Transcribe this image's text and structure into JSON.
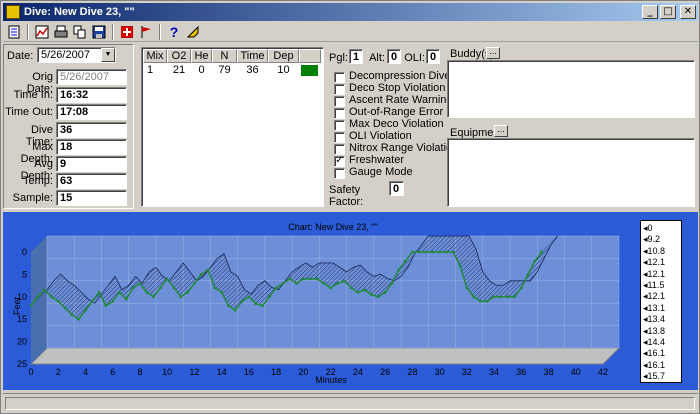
{
  "window": {
    "title": "Dive: New Dive 23, \"\"",
    "minimize": "_",
    "maximize": "□",
    "close": "✕"
  },
  "toolbar": {
    "icons": [
      "log-icon",
      "chart-icon",
      "print-icon",
      "copy-icon",
      "save-icon",
      "first-aid-icon",
      "flag-icon",
      "help-icon",
      "pointer-icon"
    ]
  },
  "details": {
    "date_label": "Date:",
    "date_value": "5/26/2007",
    "orig_date_label": "Orig Date:",
    "orig_date_value": "5/26/2007",
    "time_in_label": "Time In:",
    "time_in_value": "16:32",
    "time_out_label": "Time Out:",
    "time_out_value": "17:08",
    "dive_time_label": "Dive Time:",
    "dive_time_value": "36",
    "max_depth_label": "Max Depth:",
    "max_depth_value": "18",
    "avg_depth_label": "Avg Depth:",
    "avg_depth_value": "9",
    "temp_label": "Temp:",
    "temp_value": "63",
    "sample_label": "Sample:",
    "sample_value": "15"
  },
  "mix_table": {
    "headers": [
      "Mix",
      "O2",
      "He",
      "N",
      "Time",
      "Dep"
    ],
    "rows": [
      [
        "1",
        "21",
        "0",
        "79",
        "36",
        "10"
      ]
    ],
    "row_color": "#008000"
  },
  "indicators": {
    "pgl_label": "Pgl:",
    "pgl_value": "1",
    "alt_label": "Alt:",
    "alt_value": "0",
    "oli_label": "OLI:",
    "oli_value": "0"
  },
  "flags": [
    {
      "label": "Decompression Dive",
      "checked": false
    },
    {
      "label": "Deco Stop Violation",
      "checked": false
    },
    {
      "label": "Ascent Rate Warning",
      "checked": false
    },
    {
      "label": "Out-of-Range Error",
      "checked": false
    },
    {
      "label": "Max Deco Violation",
      "checked": false
    },
    {
      "label": "OLI Violation",
      "checked": false
    },
    {
      "label": "Nitrox Range Violation",
      "checked": false
    },
    {
      "label": "Freshwater",
      "checked": true
    },
    {
      "label": "Gauge Mode",
      "checked": false
    }
  ],
  "safety": {
    "label": "Safety Factor:",
    "value": "0"
  },
  "buddy": {
    "label": "Buddy(s)",
    "button": "..."
  },
  "equipment": {
    "label": "Equipment",
    "button": "..."
  },
  "chart_data": {
    "type": "area",
    "title": "Chart: New Dive 23, \"\"",
    "xlabel": "Minutes",
    "ylabel": "Feet",
    "xlim": [
      0,
      42
    ],
    "ylim": [
      0,
      25
    ],
    "y_reversed": true,
    "x_ticks": [
      0,
      2,
      4,
      6,
      8,
      10,
      12,
      14,
      16,
      18,
      20,
      22,
      24,
      26,
      28,
      30,
      32,
      34,
      36,
      38,
      40,
      42
    ],
    "y_ticks": [
      0,
      5,
      10,
      15,
      20,
      25
    ],
    "colors": {
      "background": "#2b5bd6",
      "plot": "#6d8fd8",
      "surface": "#4a6fb0",
      "line": "#1f8a3a",
      "grid": "#9fb4e6"
    },
    "series": [
      {
        "values": [
          [
            0,
            12
          ],
          [
            0.5,
            10
          ],
          [
            1,
            8.5
          ],
          [
            1.5,
            10
          ],
          [
            2,
            11
          ],
          [
            2.5,
            12.5
          ],
          [
            3,
            14
          ],
          [
            3.5,
            15
          ],
          [
            4,
            13
          ],
          [
            4.5,
            11
          ],
          [
            5,
            9
          ],
          [
            5.5,
            12
          ],
          [
            6,
            11
          ],
          [
            6.5,
            9
          ],
          [
            7,
            10.5
          ],
          [
            7.5,
            8
          ],
          [
            8,
            7
          ],
          [
            8.5,
            9
          ],
          [
            9,
            10
          ],
          [
            9.5,
            8
          ],
          [
            10,
            6
          ],
          [
            10.5,
            8
          ],
          [
            11,
            10
          ],
          [
            11.5,
            9
          ],
          [
            12,
            7
          ],
          [
            12.5,
            5
          ],
          [
            13,
            4
          ],
          [
            13.5,
            8
          ],
          [
            14,
            9
          ],
          [
            14.5,
            12
          ],
          [
            15,
            13
          ],
          [
            15.5,
            11
          ],
          [
            16,
            10
          ],
          [
            16.5,
            11.5
          ],
          [
            17,
            12
          ],
          [
            17.5,
            10
          ],
          [
            18,
            8
          ],
          [
            18.5,
            7
          ],
          [
            19,
            6
          ],
          [
            19.5,
            7
          ],
          [
            20,
            6
          ],
          [
            20.5,
            6
          ],
          [
            21,
            6
          ],
          [
            21.5,
            7
          ],
          [
            22,
            8
          ],
          [
            22.5,
            7
          ],
          [
            23,
            6.5
          ],
          [
            23.5,
            8
          ],
          [
            24,
            9
          ],
          [
            24.5,
            8.5
          ],
          [
            25,
            9.5
          ],
          [
            25.5,
            10
          ],
          [
            26,
            9
          ],
          [
            26.5,
            7
          ],
          [
            27,
            4
          ],
          [
            27.5,
            2
          ],
          [
            28,
            0
          ],
          [
            28.5,
            0
          ],
          [
            29,
            0
          ],
          [
            29.5,
            0
          ],
          [
            30,
            0
          ],
          [
            30.5,
            0
          ],
          [
            31,
            0
          ],
          [
            31.5,
            3
          ],
          [
            32,
            8
          ],
          [
            32.5,
            10
          ],
          [
            33,
            11
          ],
          [
            33.5,
            11
          ],
          [
            34,
            10
          ],
          [
            34.5,
            10
          ],
          [
            35,
            10
          ],
          [
            35.5,
            10
          ],
          [
            36,
            8
          ],
          [
            36.5,
            5
          ],
          [
            37,
            2
          ],
          [
            37.5,
            0
          ]
        ]
      }
    ]
  },
  "legend": {
    "items": [
      "0",
      "9.2",
      "10.8",
      "12.1",
      "12.1",
      "11.5",
      "12.1",
      "13.1",
      "13.4",
      "13.8",
      "14.4",
      "16.1",
      "16.1",
      "15.7"
    ]
  }
}
